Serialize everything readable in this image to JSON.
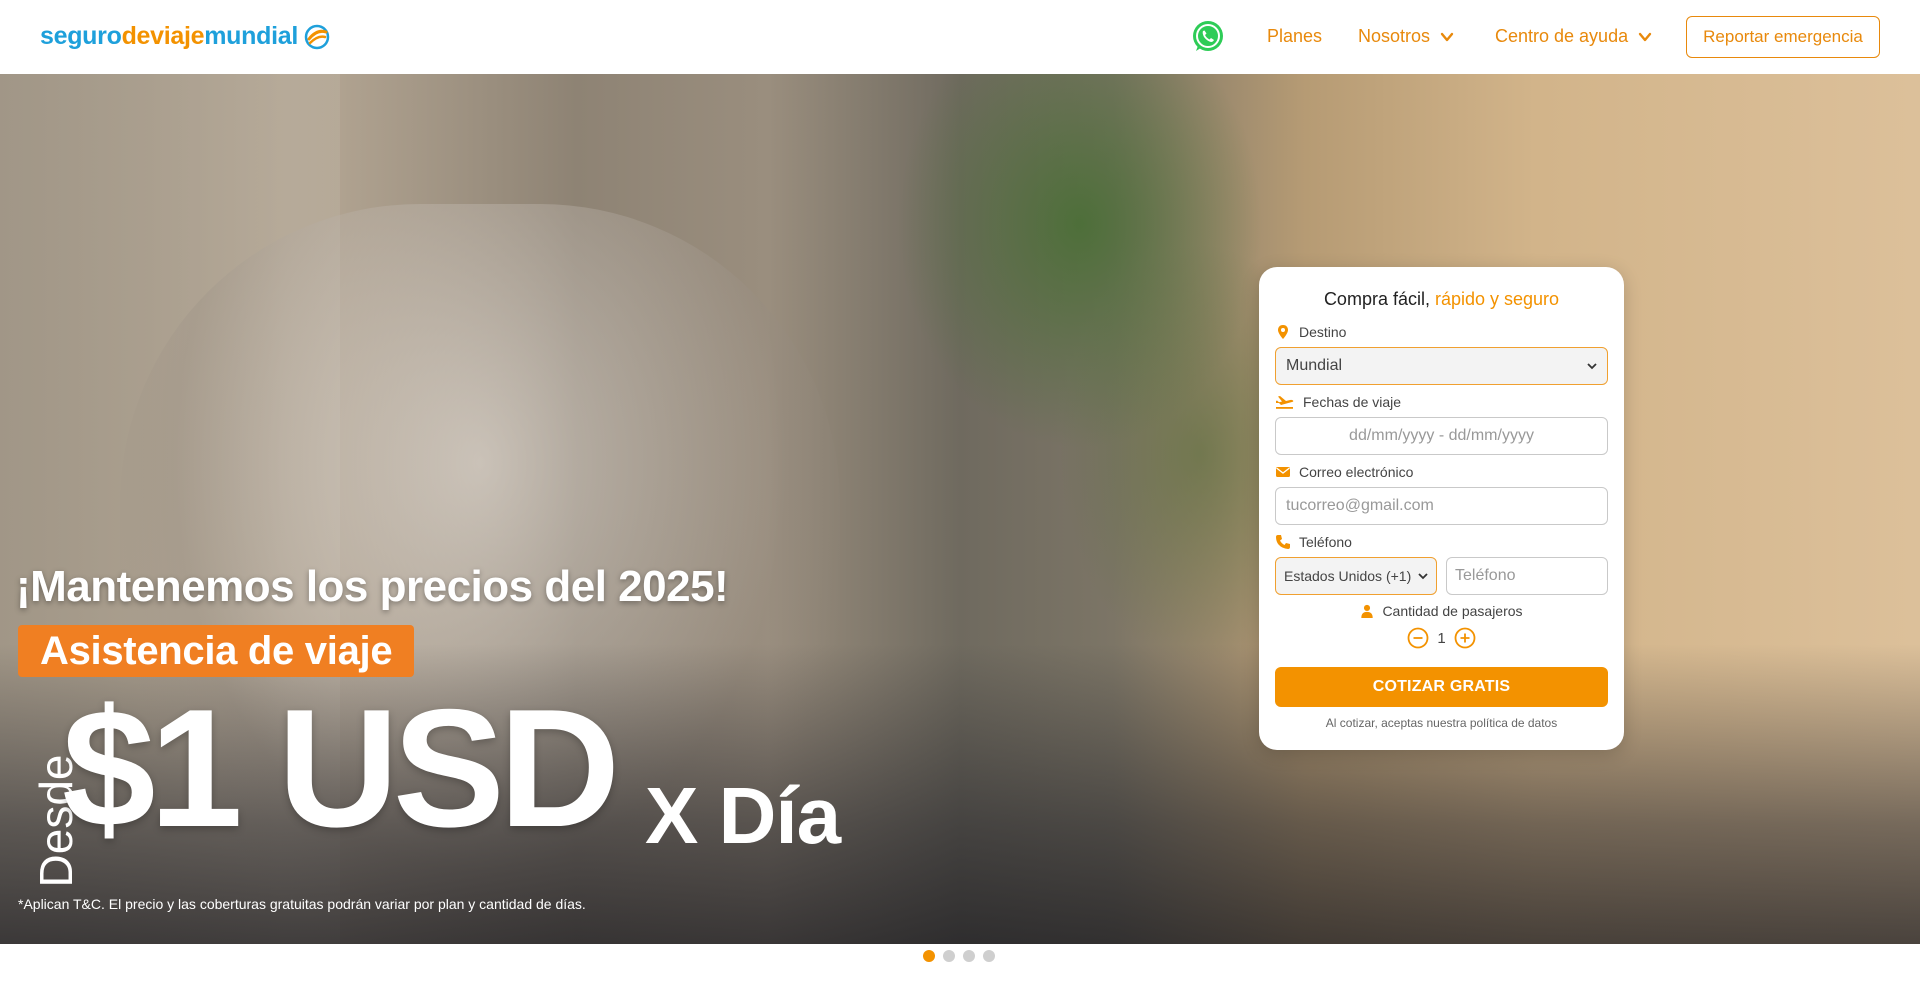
{
  "header": {
    "logo": {
      "part1": "seguro",
      "part2": "deviaje",
      "part3": "mundial"
    },
    "nav": [
      {
        "label": "Planes"
      },
      {
        "label": "Nosotros"
      },
      {
        "label": "Centro de ayuda"
      }
    ],
    "emergency_label": "Reportar emergencia"
  },
  "hero": {
    "headline": "¡Mantenemos los precios del 2025!",
    "badge": "Asistencia de viaje",
    "desde": "Desde",
    "price": "$1 USD",
    "per_day": "X Día",
    "disclaimer": "*Aplican T&C. El precio y las coberturas gratuitas podrán variar por plan y cantidad de días."
  },
  "form": {
    "title_plain": "Compra fácil, ",
    "title_accent": "rápido y seguro",
    "destino_label": "Destino",
    "destino_value": "Mundial",
    "fechas_label": "Fechas de viaje",
    "fechas_placeholder": "dd/mm/yyyy - dd/mm/yyyy",
    "correo_label": "Correo electrónico",
    "correo_placeholder": "tucorreo@gmail.com",
    "telefono_label": "Teléfono",
    "country_value": "Estados Unidos (+1)",
    "telefono_placeholder": "Teléfono",
    "pasajeros_label": "Cantidad de pasajeros",
    "pasajeros_value": "1",
    "cta_label": "COTIZAR GRATIS",
    "legal": "Al cotizar, aceptas nuestra política de datos"
  },
  "carousel": {
    "slides": 4,
    "active_index": 0
  },
  "colors": {
    "brand_orange": "#f39200",
    "brand_blue": "#1ea0db"
  },
  "icons": [
    "logo-swirl-icon",
    "whatsapp-icon",
    "chevron-down-icon",
    "map-pin-icon",
    "plane-icon",
    "envelope-icon",
    "phone-icon",
    "user-icon",
    "minus-circle-icon",
    "plus-circle-icon"
  ]
}
